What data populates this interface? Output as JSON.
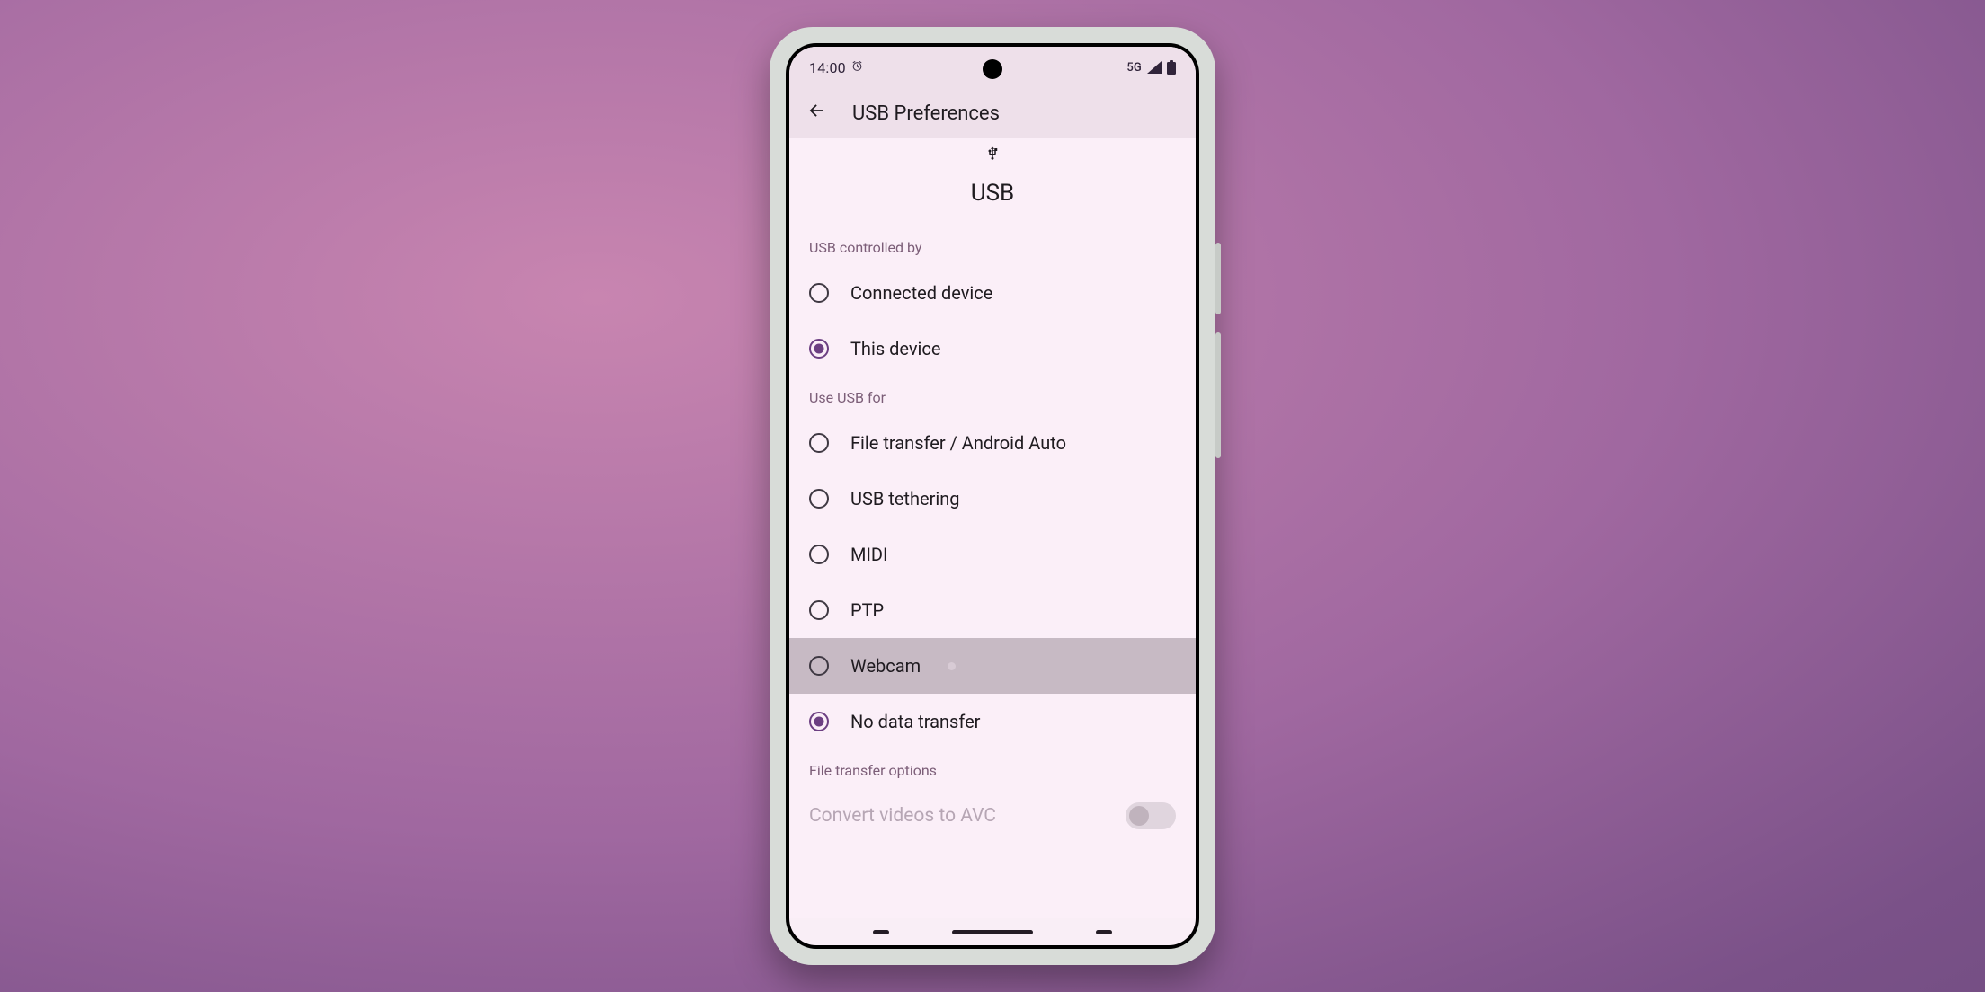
{
  "status": {
    "time": "14:00",
    "network_label": "5G"
  },
  "appbar": {
    "title": "USB Preferences"
  },
  "header": {
    "title": "USB"
  },
  "sections": {
    "controlled": {
      "title": "USB controlled by",
      "options": [
        {
          "label": "Connected device",
          "selected": false
        },
        {
          "label": "This device",
          "selected": true
        }
      ]
    },
    "use_for": {
      "title": "Use USB for",
      "options": [
        {
          "label": "File transfer / Android Auto",
          "selected": false
        },
        {
          "label": "USB tethering",
          "selected": false
        },
        {
          "label": "MIDI",
          "selected": false
        },
        {
          "label": "PTP",
          "selected": false
        },
        {
          "label": "Webcam",
          "selected": false,
          "highlight": true
        },
        {
          "label": "No data transfer",
          "selected": true
        }
      ]
    },
    "file_transfer": {
      "title": "File transfer options",
      "toggle_label": "Convert videos to AVC",
      "toggle_on": false,
      "toggle_enabled": false
    }
  }
}
